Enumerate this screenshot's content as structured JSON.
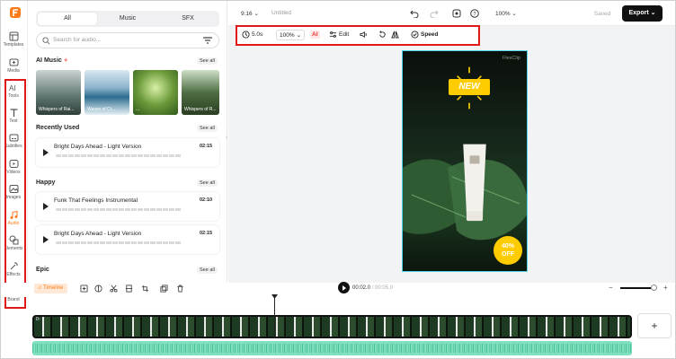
{
  "colors": {
    "accent": "#ff7a1a",
    "highlight_box": "#e01818",
    "export_bg": "#111111",
    "audio_track": "#7ee0bd",
    "video_border": "#4fd3e8"
  },
  "rail": {
    "items": [
      {
        "label": "Templates",
        "icon": "templates-icon"
      },
      {
        "label": "Media",
        "icon": "media-icon"
      },
      {
        "label": "Tools",
        "icon": "ai-tools-icon"
      },
      {
        "label": "Text",
        "icon": "text-icon"
      },
      {
        "label": "Subtitles",
        "icon": "subtitles-icon"
      },
      {
        "label": "Videos",
        "icon": "videos-icon"
      },
      {
        "label": "Images",
        "icon": "images-icon"
      },
      {
        "label": "Audio",
        "icon": "audio-icon",
        "active": true
      },
      {
        "label": "Elements",
        "icon": "elements-icon"
      },
      {
        "label": "Effects",
        "icon": "effects-icon"
      },
      {
        "label": "Brand",
        "icon": "brand-icon"
      }
    ]
  },
  "panel": {
    "tabs": [
      "All",
      "Music",
      "SFX"
    ],
    "selected_tab": "All",
    "search_placeholder": "Search for audio...",
    "see_all": "See all",
    "ai_music": {
      "title": "AI Music",
      "thumbs": [
        "Whispers of Rai...",
        "Waves of Cr...",
        "...",
        "Whispers of R..."
      ]
    },
    "recently_used": {
      "title": "Recently Used",
      "tracks": [
        {
          "name": "Bright Days Ahead - Light Version",
          "duration": "02:15"
        }
      ]
    },
    "happy": {
      "title": "Happy",
      "tracks": [
        {
          "name": "Funk That Feelings Instrumental",
          "duration": "02:10"
        },
        {
          "name": "Bright Days Ahead - Light Version",
          "duration": "02:15"
        }
      ]
    },
    "epic": {
      "title": "Epic"
    }
  },
  "topbar": {
    "ratio": "9:16",
    "title": "Untitled",
    "zoom": "100%",
    "saved": "Saved",
    "export": "Export"
  },
  "toolbar": {
    "duration": "5.0s",
    "scale": "100%",
    "ai": "AI",
    "edit": "Edit",
    "speed": "Speed"
  },
  "canvas": {
    "watermark": "FlexClip",
    "badge_new": "NEW",
    "badge_off_top": "40%",
    "badge_off_bottom": "OFF"
  },
  "timeline": {
    "label": "Timeline",
    "current": "00:02.0",
    "total": "00:05.0",
    "zoom_minus": "−",
    "zoom_plus": "+",
    "add": "+",
    "clip_tag": "0↑"
  }
}
